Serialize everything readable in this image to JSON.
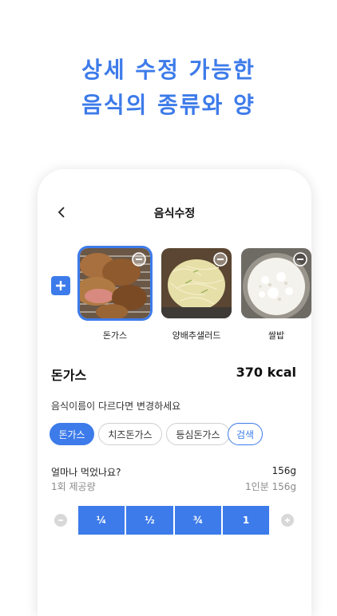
{
  "headline": {
    "line1": "상세 수정 가능한",
    "line2": "음식의 종류와 양"
  },
  "header": {
    "back_icon": "chevron-left-icon",
    "title": "음식수정"
  },
  "add_button": {
    "icon": "plus-icon"
  },
  "foods": [
    {
      "name": "돈가스",
      "selected": true
    },
    {
      "name": "양배추샐러드",
      "selected": false
    },
    {
      "name": "쌀밥",
      "selected": false
    }
  ],
  "detail": {
    "name": "돈가스",
    "kcal": "370 kcal"
  },
  "rename": {
    "hint": "음식이름이 다르다면 변경하세요",
    "chips": [
      "돈가스",
      "치즈돈가스",
      "등심돈가스"
    ],
    "search_label": "검색"
  },
  "quantity": {
    "question": "얼마나 먹었나요?",
    "amount": "156g",
    "serving_label": "1회 제공량",
    "serving_value": "1인분 156g",
    "segments": [
      "¼",
      "½",
      "¾",
      "1"
    ]
  },
  "colors": {
    "accent": "#3d7bea",
    "muted": "#d8d8d8"
  }
}
